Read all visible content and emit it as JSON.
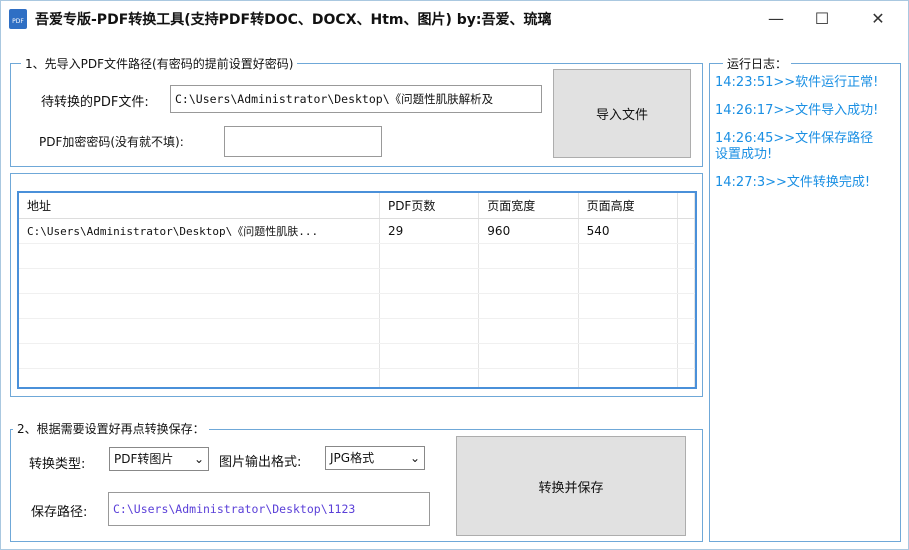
{
  "window": {
    "title": "吾爱专版-PDF转换工具(支持PDF转DOC、DOCX、Htm、图片) by:吾爱、琉璃",
    "icon": "PDF",
    "minimize": "—",
    "maximize": "☐",
    "close": "✕"
  },
  "section1": {
    "legend": "1、先导入PDF文件路径(有密码的提前设置好密码)",
    "file_label": "待转换的PDF文件:",
    "file_value": "C:\\Users\\Administrator\\Desktop\\《问题性肌肤解析及",
    "password_label": "PDF加密密码(没有就不填):",
    "password_value": "",
    "import_button": "导入文件"
  },
  "table": {
    "headers": [
      "地址",
      "PDF页数",
      "页面宽度",
      "页面高度"
    ],
    "rows": [
      [
        "C:\\Users\\Administrator\\Desktop\\《问题性肌肤...",
        "29",
        "960",
        "540"
      ]
    ]
  },
  "section2": {
    "legend": "2、根据需要设置好再点转换保存：",
    "type_label": "转换类型:",
    "type_value": "PDF转图片",
    "format_label": "图片输出格式:",
    "format_value": "JPG格式",
    "save_label": "保存路径:",
    "save_value": "C:\\Users\\Administrator\\Desktop\\1123",
    "convert_button": "转换并保存"
  },
  "log": {
    "legend": "运行日志：",
    "entries": [
      "14:23:51>>软件运行正常!",
      "14:26:17>>文件导入成功!",
      "14:26:45>>文件保存路径设置成功!",
      "14:27:3>>文件转换完成!"
    ]
  }
}
